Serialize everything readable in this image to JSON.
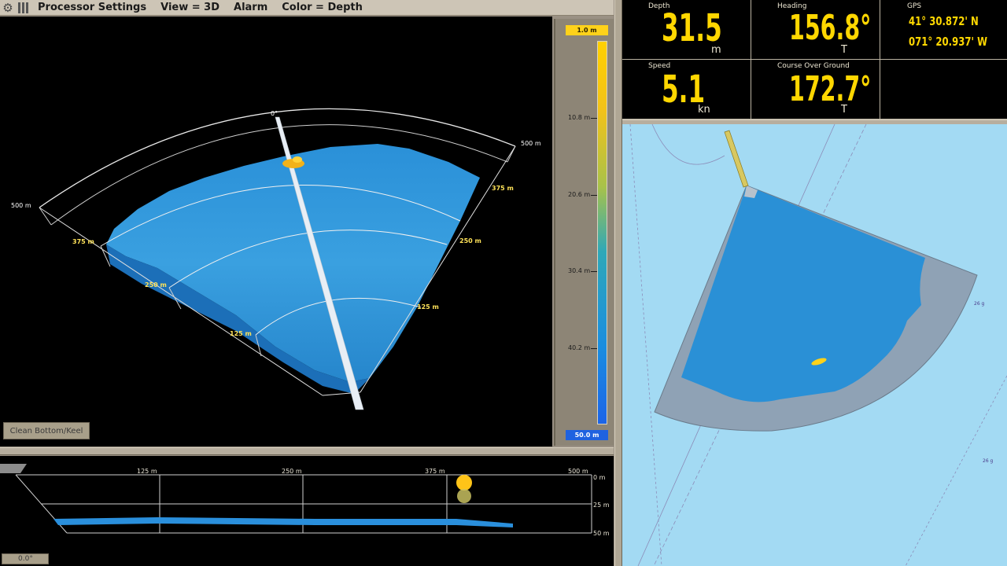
{
  "menu": {
    "items": [
      "Processor Settings",
      "View = 3D",
      "Alarm",
      "Color = Depth"
    ]
  },
  "view3d": {
    "heading_label": "0°",
    "range_labels": {
      "outer_left": "500 m",
      "outer_right": "500 m",
      "r375_left": "375 m",
      "r375_right": "375 m",
      "r250_left": "250 m",
      "r250_right": "250 m",
      "r125_left": "125 m",
      "r125_right": "125 m"
    },
    "clean_button": "Clean Bottom/Keel"
  },
  "depth_scale": {
    "top": "1.0 m",
    "bottom": "50.0 m",
    "ticks": [
      "10.8 m",
      "20.6 m",
      "30.4 m",
      "40.2 m"
    ]
  },
  "profile": {
    "x_labels": [
      "125 m",
      "250 m",
      "375 m",
      "500 m"
    ],
    "y_labels": [
      "0 m",
      "25 m",
      "50 m"
    ],
    "angle": "0.0°"
  },
  "instruments": {
    "depth": {
      "label": "Depth",
      "value": "31.5",
      "unit": "m"
    },
    "heading": {
      "label": "Heading",
      "value": "156.8°",
      "unit": "T"
    },
    "gps": {
      "label": "GPS",
      "lat": "41° 30.872' N",
      "lon": "071° 20.937' W"
    },
    "speed": {
      "label": "Speed",
      "value": "5.1",
      "unit": "kn"
    },
    "cog": {
      "label": "Course Over Ground",
      "value": "172.7°",
      "unit": "T"
    }
  },
  "chart": {
    "soundings": [
      "26 g",
      "26 g"
    ]
  },
  "colors": {
    "accent_yellow": "#ffd700",
    "sonar_blue": "#2a8fdc",
    "chart_water": "#a3daf3",
    "panel": "#9a9184"
  }
}
